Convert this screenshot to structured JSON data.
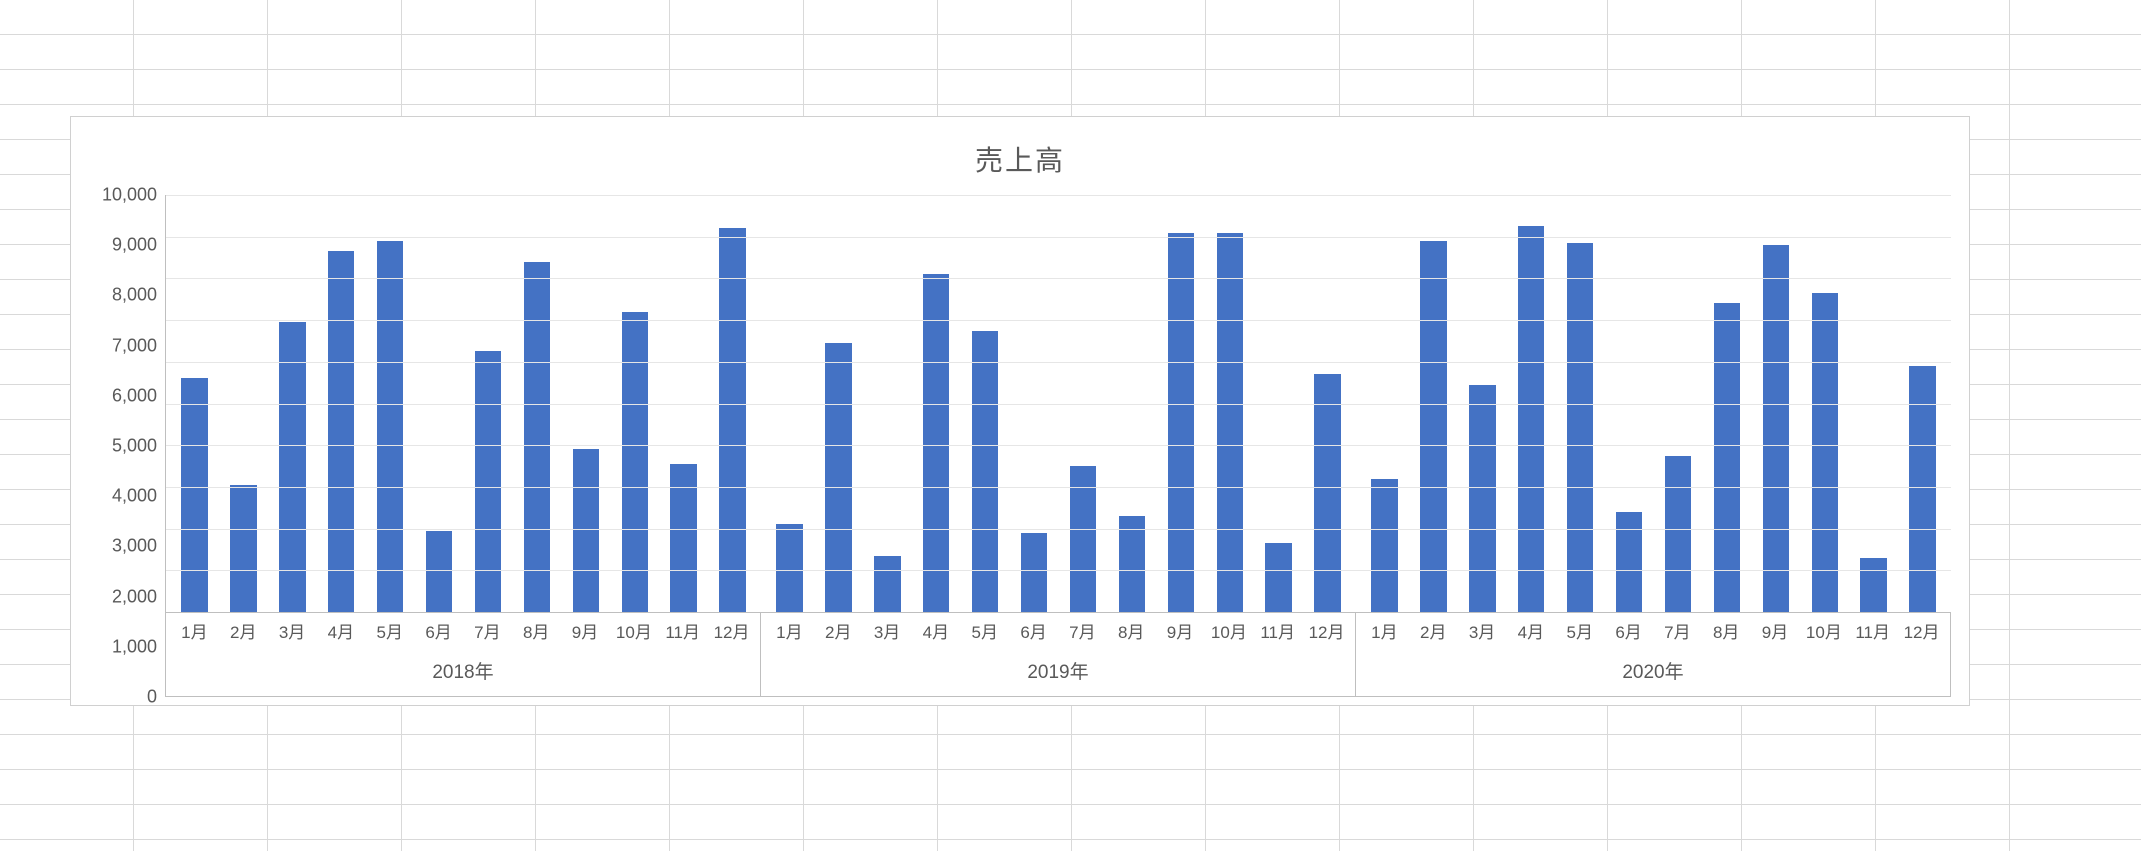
{
  "chart_data": {
    "type": "bar",
    "title": "売上高",
    "ylabel": "",
    "xlabel": "",
    "ylim": [
      0,
      10000
    ],
    "y_ticks": [
      0,
      1000,
      2000,
      3000,
      4000,
      5000,
      6000,
      7000,
      8000,
      9000,
      10000
    ],
    "y_tick_labels": [
      "0",
      "1,000",
      "2,000",
      "3,000",
      "4,000",
      "5,000",
      "6,000",
      "7,000",
      "8,000",
      "9,000",
      "10,000"
    ],
    "bar_color": "#4472c4",
    "groups": [
      {
        "name": "2018年",
        "categories": [
          "1月",
          "2月",
          "3月",
          "4月",
          "5月",
          "6月",
          "7月",
          "8月",
          "9月",
          "10月",
          "11月",
          "12月"
        ],
        "values": [
          5600,
          3050,
          6950,
          8650,
          8900,
          1950,
          6250,
          8400,
          3900,
          7200,
          3550,
          9200
        ]
      },
      {
        "name": "2019年",
        "categories": [
          "1月",
          "2月",
          "3月",
          "4月",
          "5月",
          "6月",
          "7月",
          "8月",
          "9月",
          "10月",
          "11月",
          "12月"
        ],
        "values": [
          2100,
          6450,
          1350,
          8100,
          6750,
          1900,
          3500,
          2300,
          9100,
          9100,
          1650,
          5700
        ]
      },
      {
        "name": "2020年",
        "categories": [
          "1月",
          "2月",
          "3月",
          "4月",
          "5月",
          "6月",
          "7月",
          "8月",
          "9月",
          "10月",
          "11月",
          "12月"
        ],
        "values": [
          3200,
          8900,
          5450,
          9250,
          8850,
          2400,
          3750,
          7400,
          8800,
          7650,
          1300,
          5900
        ]
      }
    ]
  }
}
